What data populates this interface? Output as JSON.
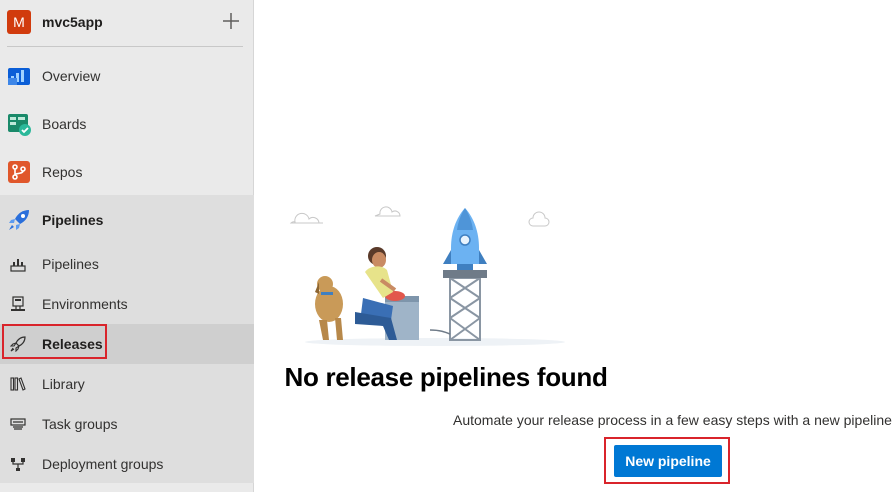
{
  "project": {
    "initial": "M",
    "name": "mvc5app",
    "avatar_color": "#d13b0d"
  },
  "sidebar": {
    "items": [
      {
        "label": "Overview",
        "icon": "overview-icon"
      },
      {
        "label": "Boards",
        "icon": "boards-icon"
      },
      {
        "label": "Repos",
        "icon": "repos-icon"
      },
      {
        "label": "Pipelines",
        "icon": "pipelines-icon"
      }
    ],
    "pipelines_sub": [
      {
        "label": "Pipelines",
        "icon": "pipelines-rocket-icon"
      },
      {
        "label": "Environments",
        "icon": "environments-icon"
      },
      {
        "label": "Releases",
        "icon": "releases-rocket-icon",
        "selected": true
      },
      {
        "label": "Library",
        "icon": "library-icon"
      },
      {
        "label": "Task groups",
        "icon": "task-groups-icon"
      },
      {
        "label": "Deployment groups",
        "icon": "deployment-groups-icon"
      }
    ]
  },
  "main": {
    "title": "No release pipelines found",
    "subtitle": "Automate your release process in a few easy steps with a new pipeline",
    "button_label": "New pipeline"
  },
  "colors": {
    "accent": "#0078d4",
    "highlight": "#d9242b"
  }
}
